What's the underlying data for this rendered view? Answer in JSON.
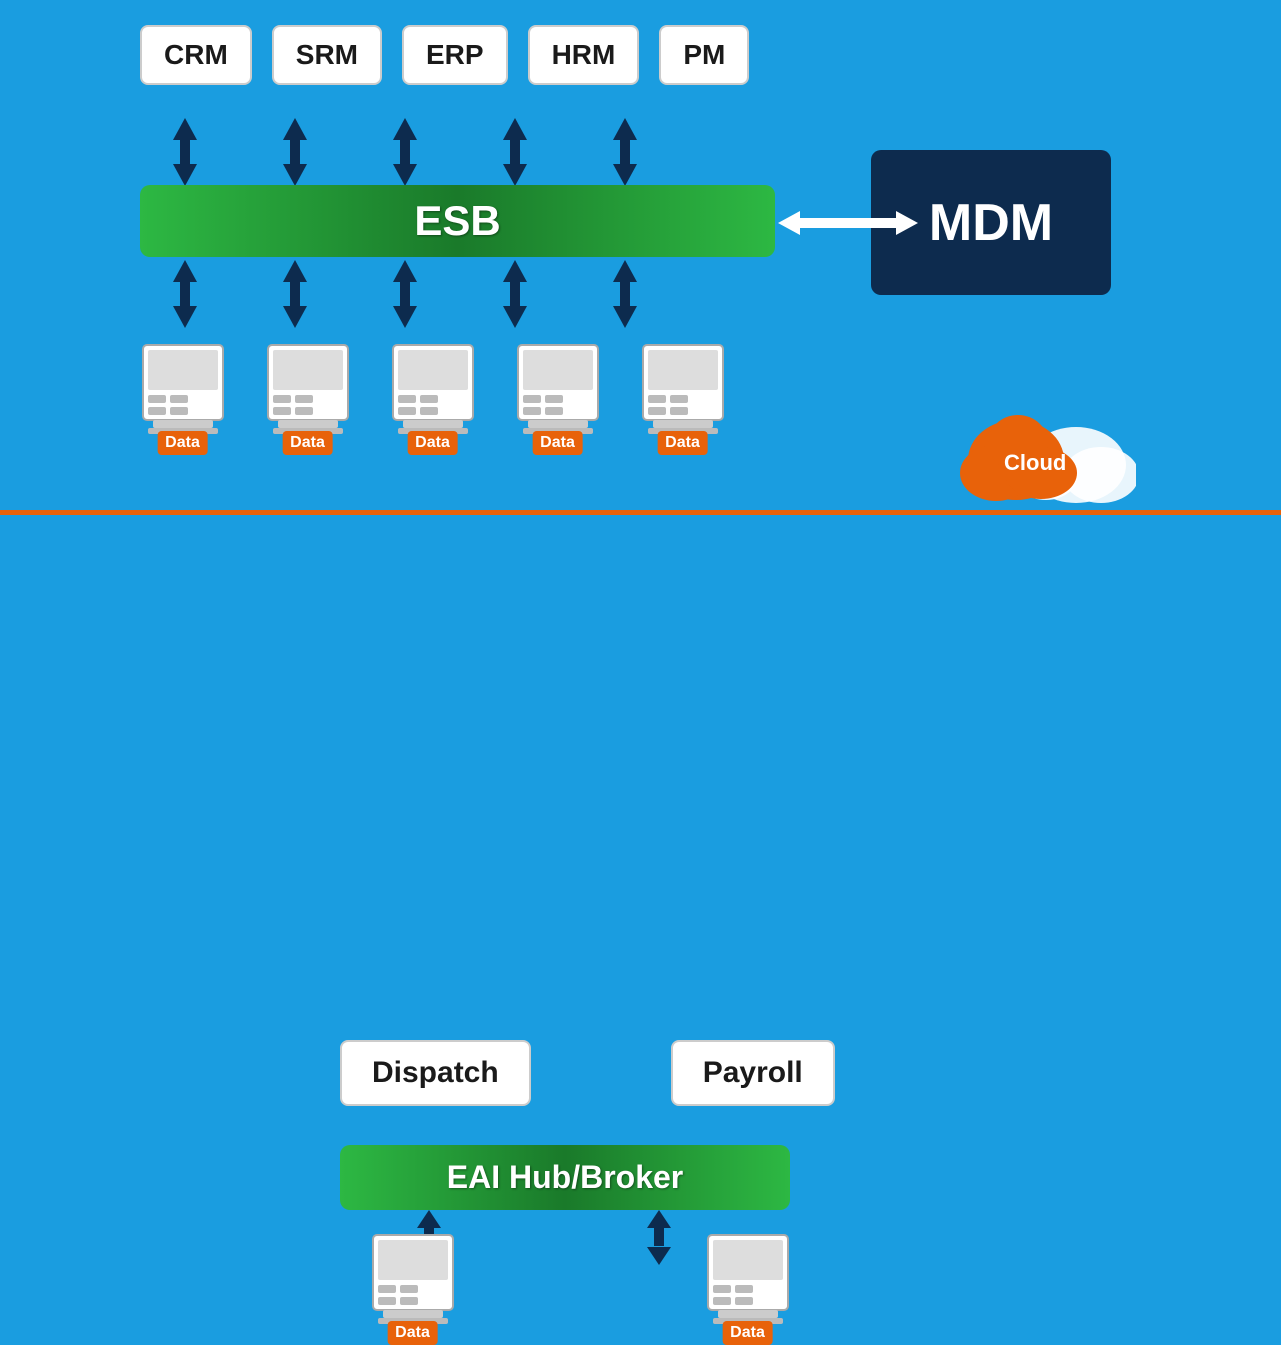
{
  "background_color": "#1a9de0",
  "divider_color": "#e8620a",
  "top_boxes": [
    {
      "label": "CRM"
    },
    {
      "label": "SRM"
    },
    {
      "label": "ERP"
    },
    {
      "label": "HRM"
    },
    {
      "label": "PM"
    }
  ],
  "esb": {
    "label": "ESB"
  },
  "mdm": {
    "label": "MDM"
  },
  "data_labels": [
    "Data",
    "Data",
    "Data",
    "Data",
    "Data"
  ],
  "cloud": {
    "label": "Cloud"
  },
  "bottom_boxes": [
    {
      "label": "Dispatch"
    },
    {
      "label": "Payroll"
    }
  ],
  "eai": {
    "label": "EAI Hub/Broker"
  },
  "bottom_data_labels": [
    "Data",
    "Data"
  ]
}
